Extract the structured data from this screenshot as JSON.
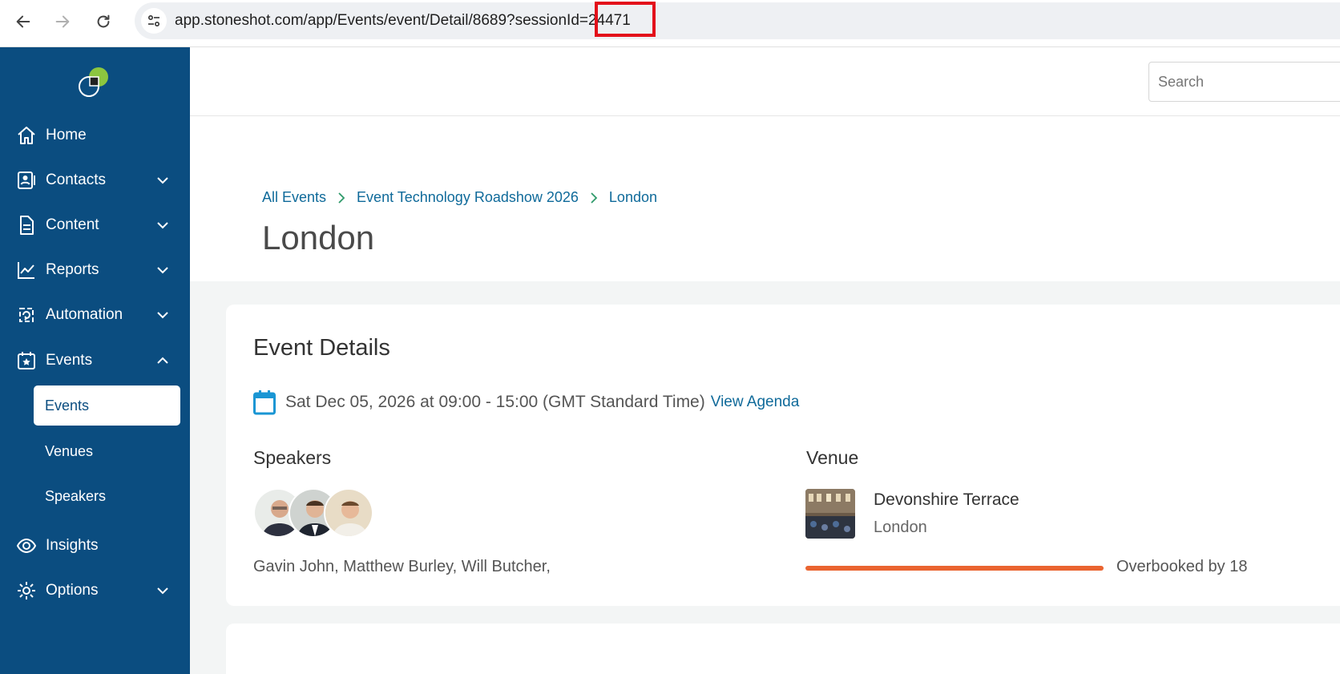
{
  "browser": {
    "url": "app.stoneshot.com/app/Events/event/Detail/8689?sessionId=24471"
  },
  "sidebar": {
    "items": [
      {
        "label": "Home",
        "icon": "home-icon"
      },
      {
        "label": "Contacts",
        "icon": "contacts-icon"
      },
      {
        "label": "Content",
        "icon": "document-icon"
      },
      {
        "label": "Reports",
        "icon": "chart-line-icon"
      },
      {
        "label": "Automation",
        "icon": "automation-icon"
      },
      {
        "label": "Events",
        "icon": "calendar-star-icon"
      },
      {
        "label": "Insights",
        "icon": "eye-icon"
      },
      {
        "label": "Options",
        "icon": "gear-icon"
      }
    ],
    "events_sub": [
      "Events",
      "Venues",
      "Speakers"
    ]
  },
  "topbar": {
    "search_placeholder": "Search"
  },
  "breadcrumb": [
    "All Events",
    "Event Technology Roadshow 2026",
    "London"
  ],
  "page_title": "London",
  "event_details": {
    "title": "Event Details",
    "datetime": "Sat Dec 05, 2026 at 09:00 - 15:00 (GMT Standard Time)",
    "agenda_link": "View Agenda",
    "speakers_label": "Speakers",
    "speaker_names": "Gavin John, Matthew Burley, Will Butcher,",
    "venue_label": "Venue",
    "venue_name": "Devonshire Terrace",
    "venue_city": "London",
    "capacity_text": "Overbooked by 18",
    "capacity_fraction": 1.0
  },
  "colors": {
    "sidebar": "#0b4d80",
    "link": "#0f6a9a",
    "overbooked": "#ea6430",
    "highlight": "#e3101a"
  }
}
